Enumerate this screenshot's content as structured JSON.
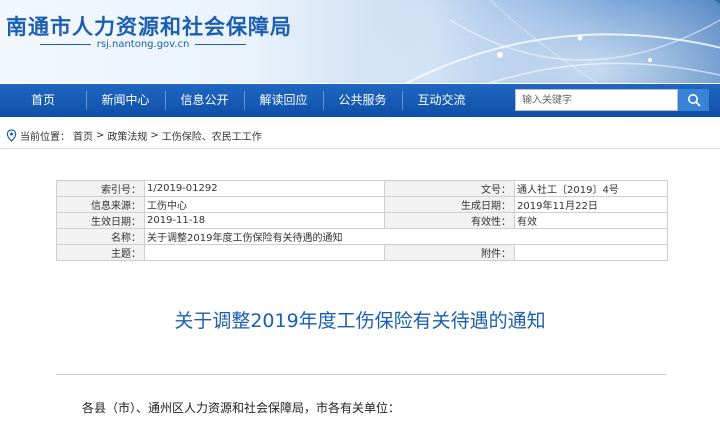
{
  "header": {
    "site_title": "南通市人力资源和社会保障局",
    "site_url": "rsj.nantong.gov.cn"
  },
  "nav": {
    "items": [
      "首页",
      "新闻中心",
      "信息公开",
      "解读回应",
      "公共服务",
      "互动交流"
    ]
  },
  "search": {
    "placeholder": "输入关键字"
  },
  "breadcrumb": {
    "label": "当前位置：",
    "items": [
      "首页",
      "政策法规",
      "工伤保险、农民工工作"
    ],
    "separator": ">"
  },
  "meta": {
    "index_no_label": "索引号：",
    "index_no": "1/2019-01292",
    "doc_no_label": "文号：",
    "doc_no": "通人社工〔2019〕4号",
    "source_label": "信息来源：",
    "source": "工伤中心",
    "created_label": "生成日期：",
    "created": "2019年11月22日",
    "effective_label": "生效日期：",
    "effective": "2019-11-18",
    "validity_label": "有效性：",
    "validity": "有效",
    "name_label": "名称：",
    "name": "关于调整2019年度工伤保险有关待遇的通知",
    "subject_label": "主题：",
    "subject": "",
    "attachment_label": "附件：",
    "attachment": ""
  },
  "article": {
    "title": "关于调整2019年度工伤保险有关待遇的通知",
    "salutation": "各县（市）、通州区人力资源和社会保障局，市各有关单位："
  },
  "colors": {
    "brand_blue": "#1b5fb0",
    "nav_blue": "#1258b4",
    "search_button": "#3a82d6"
  },
  "icons": {
    "search": "search-icon",
    "location": "location-pin-icon"
  }
}
